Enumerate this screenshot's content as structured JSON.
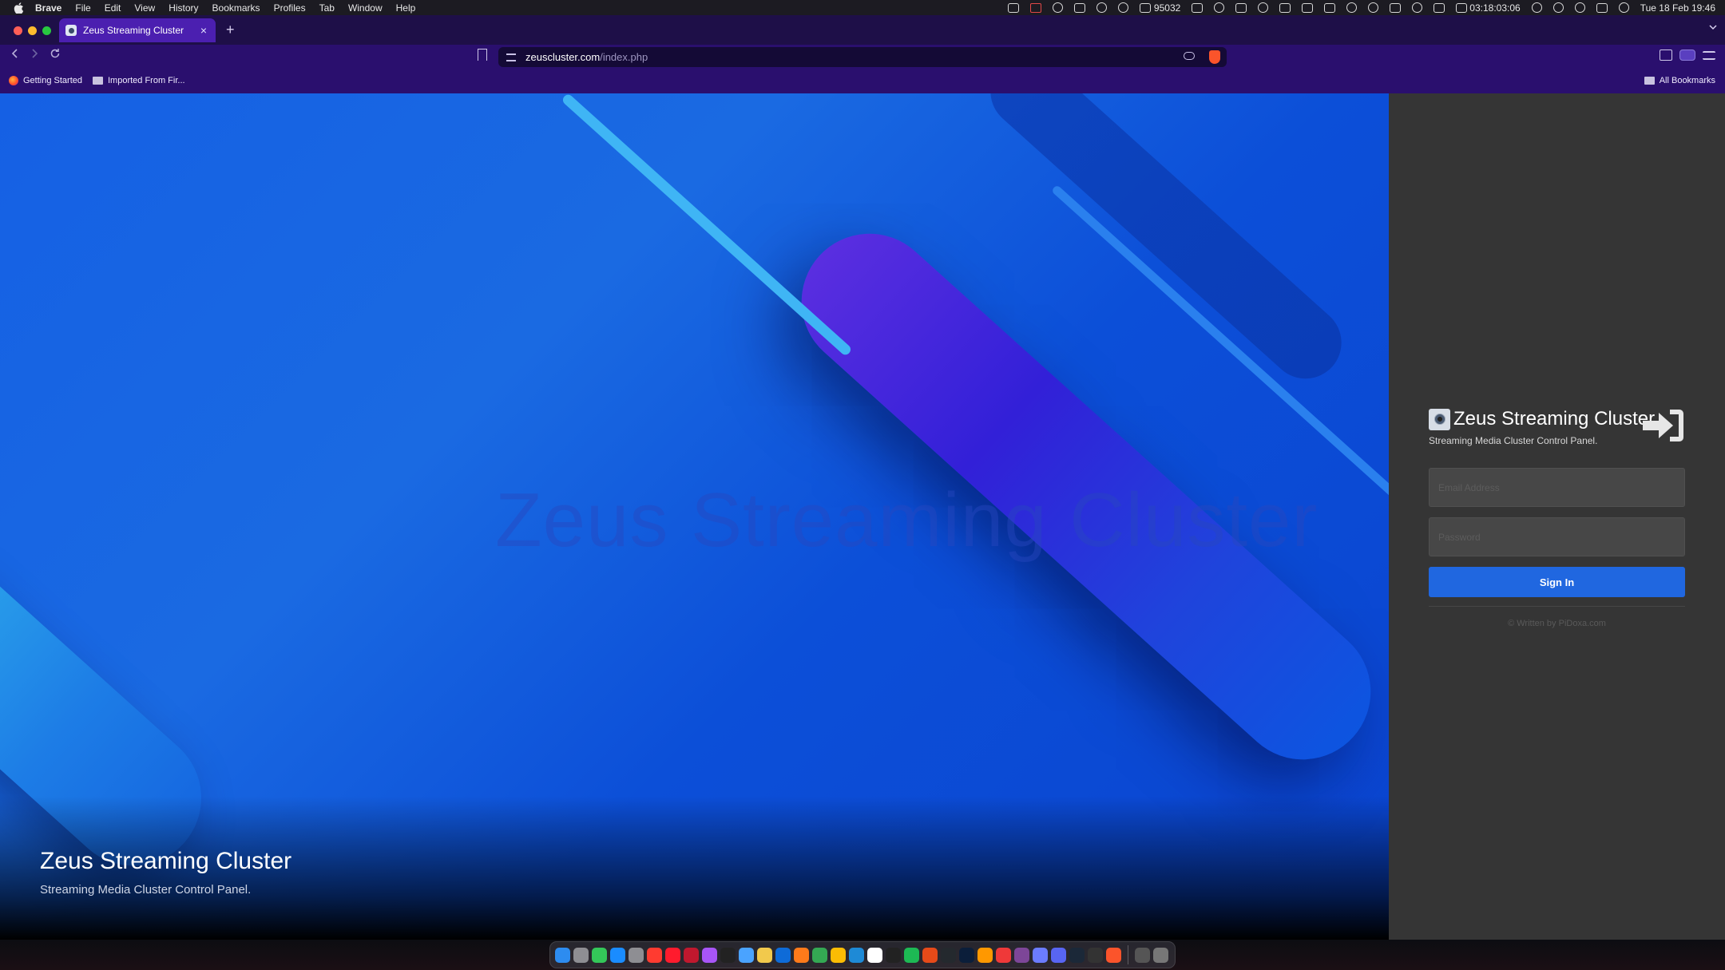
{
  "menubar": {
    "app_name": "Brave",
    "items": [
      "File",
      "Edit",
      "View",
      "History",
      "Bookmarks",
      "Profiles",
      "Tab",
      "Window",
      "Help"
    ],
    "mail_count": "95032",
    "timer": "03:18:03:06",
    "datetime": "Tue 18 Feb  19:46"
  },
  "browser": {
    "tab_title": "Zeus Streaming Cluster",
    "tab_close": "×",
    "new_tab": "+",
    "url_host": "zeuscluster.com",
    "url_path": "/index.php",
    "bookmarks": [
      "Getting Started",
      "Imported From Fir..."
    ],
    "all_bookmarks": "All Bookmarks"
  },
  "hero": {
    "ghost_title": "Zeus Streaming Cluster",
    "title": "Zeus Streaming Cluster",
    "subtitle": "Streaming Media Cluster Control Panel."
  },
  "login": {
    "brand_title": "Zeus Streaming Cluster",
    "brand_subtitle": "Streaming Media Cluster Control Panel.",
    "email_placeholder": "Email Address",
    "password_placeholder": "Password",
    "signin_label": "Sign In",
    "credit": "© Written by PiDoxa.com"
  },
  "colors": {
    "accent": "#2067e0",
    "panel": "#353535",
    "browser_chrome": "#2a0f6e",
    "tab_active": "#4b1fb0"
  },
  "dock": {
    "apps": [
      "finder",
      "launchpad",
      "messages",
      "app-store",
      "system-settings",
      "news",
      "opera",
      "opera-gx",
      "podcasts",
      "tv",
      "preview",
      "notes",
      "teamviewer",
      "firefox",
      "chrome",
      "chrome-alt",
      "vscode",
      "calendar",
      "terminal",
      "spotify",
      "stack",
      "github",
      "photoshop",
      "sublime",
      "vivaldi",
      "tor",
      "arc",
      "discord",
      "steam",
      "prompt",
      "brave",
      "iphone-mirroring",
      "trash"
    ]
  }
}
